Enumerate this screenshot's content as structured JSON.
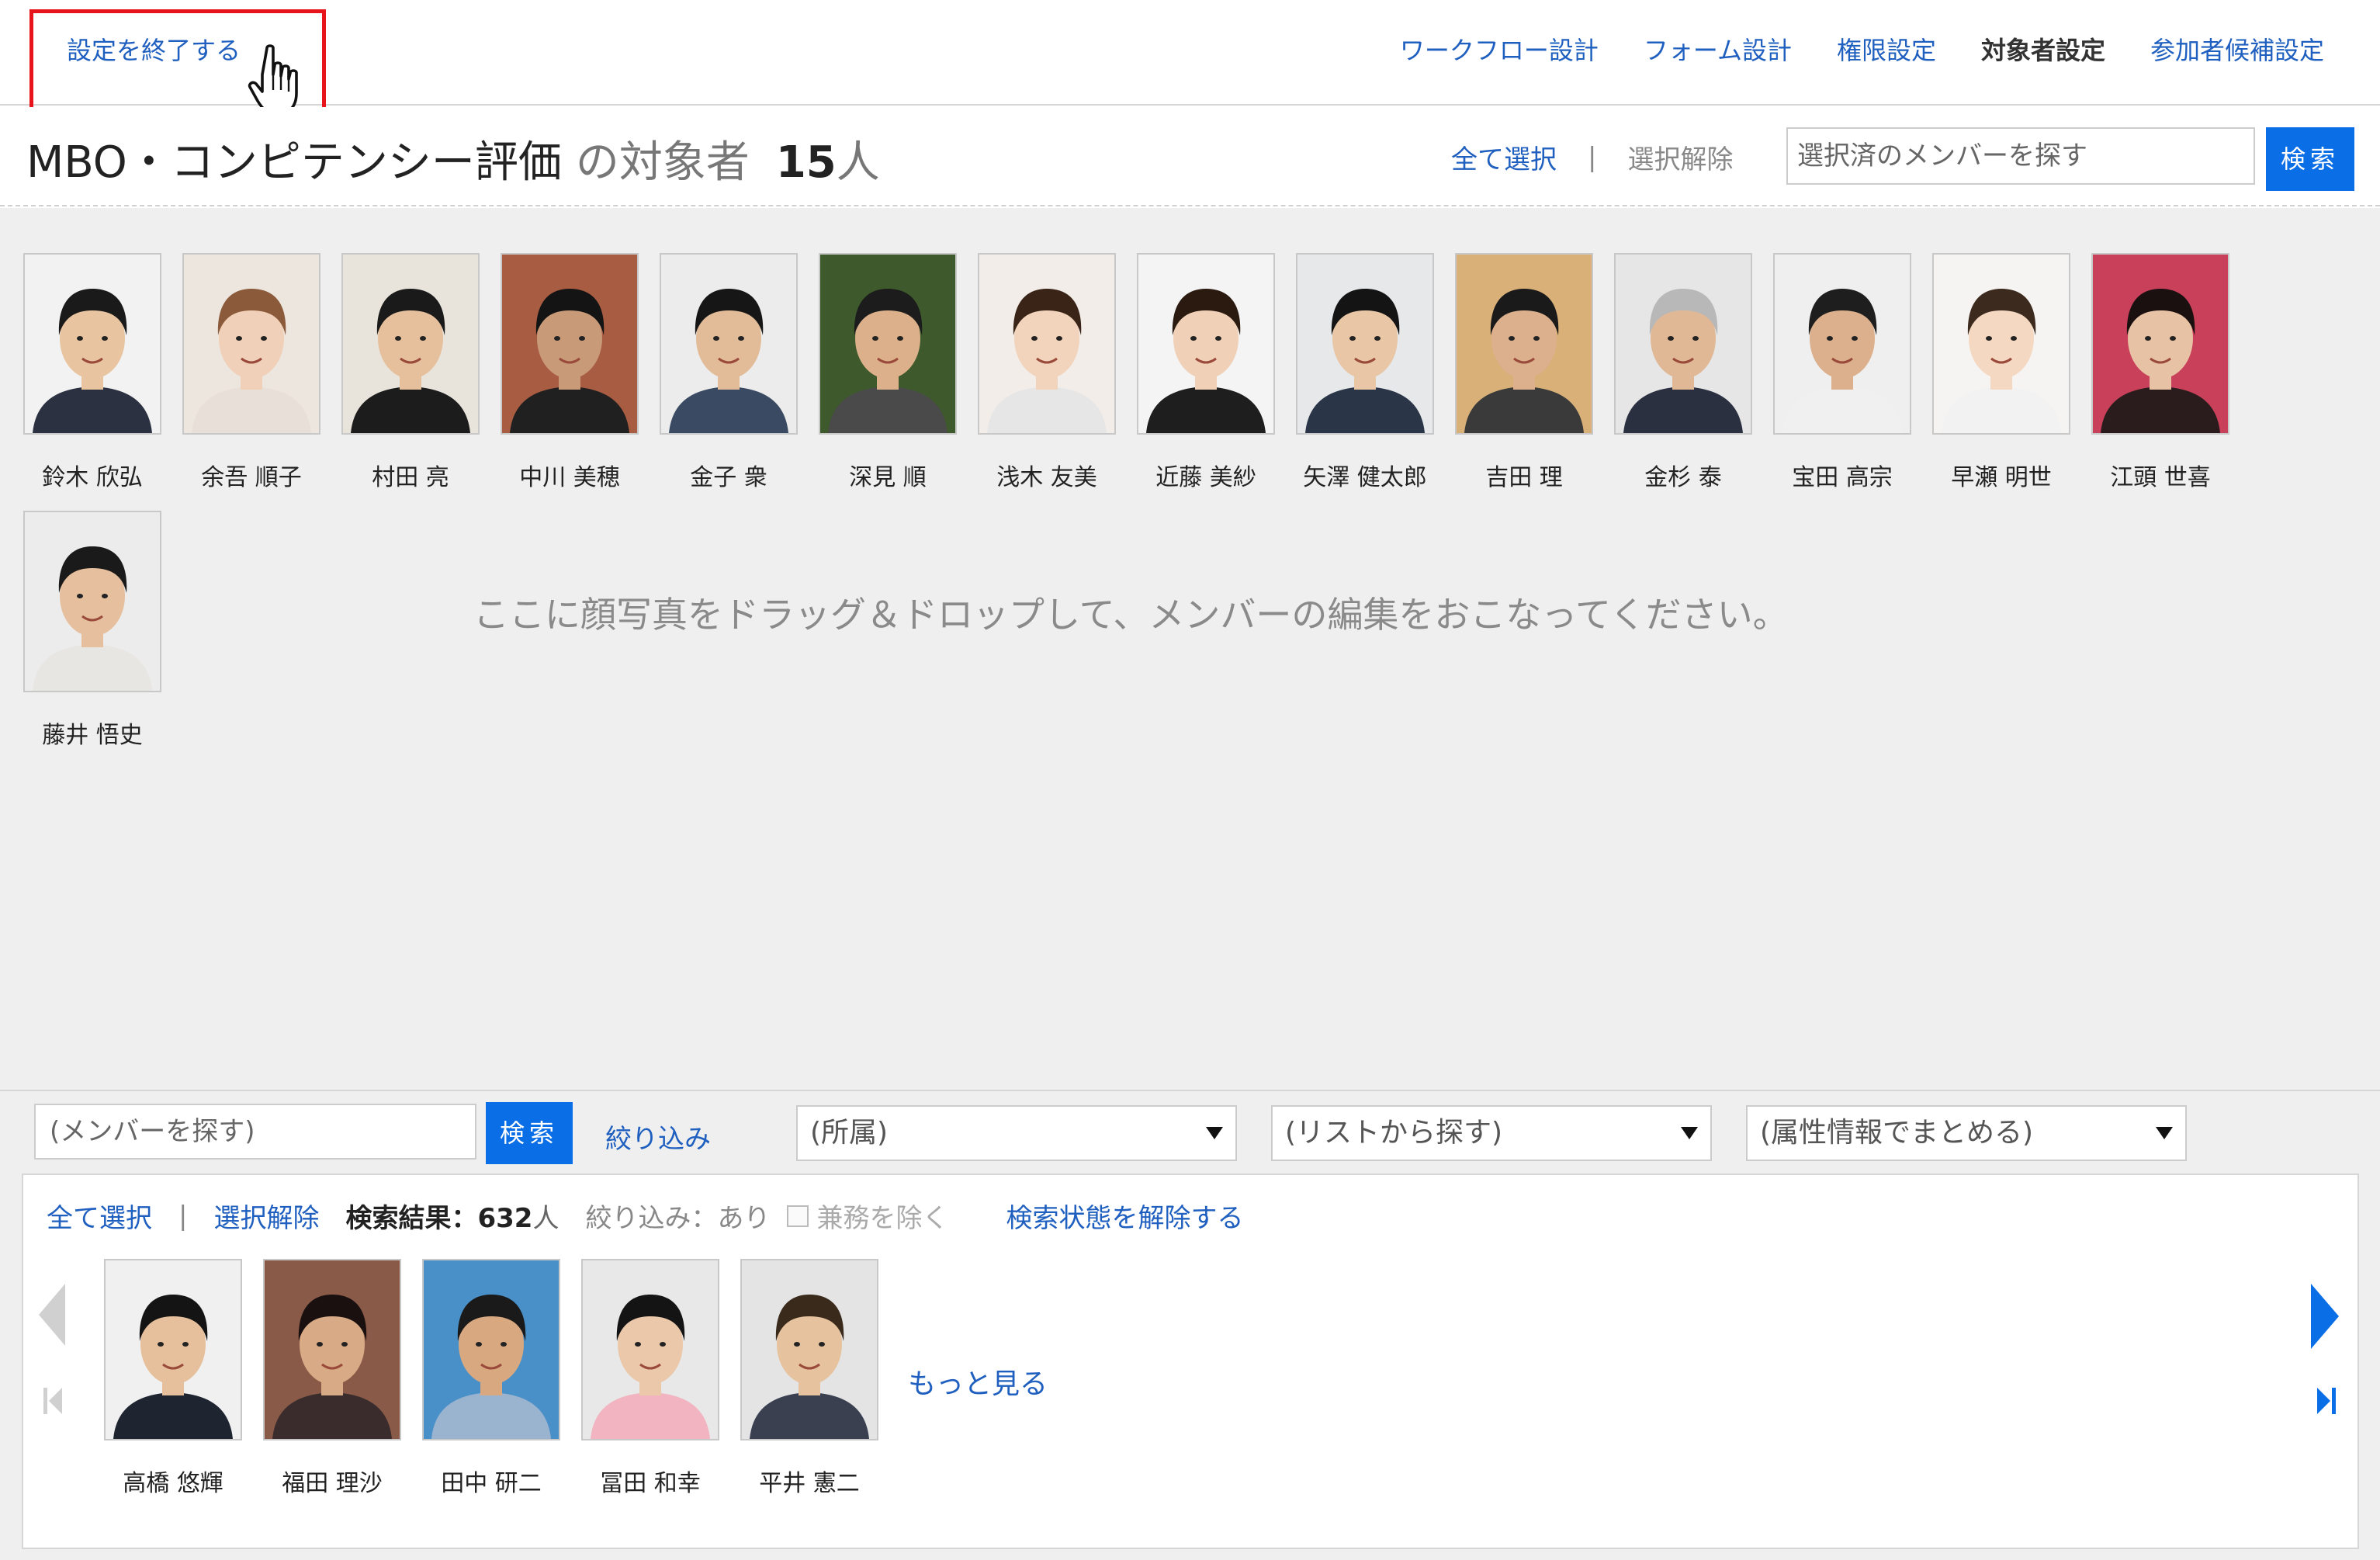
{
  "topnav": {
    "exit_label": "設定を終了する",
    "links": [
      "ワークフロー設計",
      "フォーム設計",
      "権限設定",
      "対象者設定",
      "参加者候補設定"
    ],
    "active_index": 3
  },
  "header": {
    "title_main": "MBO・コンピテンシー評価",
    "title_suffix": "の対象者",
    "count": "15",
    "count_unit": "人",
    "select_all": "全て選択",
    "separator": "|",
    "deselect": "選択解除",
    "search_placeholder": "選択済のメンバーを探す",
    "search_button": "検索"
  },
  "selected_members": [
    {
      "name": "鈴木 欣弘",
      "bg": "#f2f2f2",
      "hair": "#1a1a1a",
      "skin": "#e8c4a0",
      "cloth": "#2b3140"
    },
    {
      "name": "余吾 順子",
      "bg": "#ece6df",
      "hair": "#8a5a3a",
      "skin": "#f0d0b8",
      "cloth": "#e8e0d8"
    },
    {
      "name": "村田 亮",
      "bg": "#e8e4dc",
      "hair": "#1a1a1a",
      "skin": "#e6c09c",
      "cloth": "#1c1c1c"
    },
    {
      "name": "中川 美穂",
      "bg": "#a85c42",
      "hair": "#141414",
      "skin": "#c89a78",
      "cloth": "#202020"
    },
    {
      "name": "金子 衆",
      "bg": "#ececec",
      "hair": "#161616",
      "skin": "#e2bc98",
      "cloth": "#3a4a62"
    },
    {
      "name": "深見 順",
      "bg": "#3e5a2c",
      "hair": "#1c1c1c",
      "skin": "#dcb08a",
      "cloth": "#4a4a4a"
    },
    {
      "name": "浅木 友美",
      "bg": "#f2ede8",
      "hair": "#3a2418",
      "skin": "#f2d4bc",
      "cloth": "#e6e6e6"
    },
    {
      "name": "近藤 美紗",
      "bg": "#f4f4f4",
      "hair": "#2a1a10",
      "skin": "#f0d0b6",
      "cloth": "#1e1e1e"
    },
    {
      "name": "矢澤 健太郎",
      "bg": "#e6e8ea",
      "hair": "#141414",
      "skin": "#e8c6a6",
      "cloth": "#2a3548"
    },
    {
      "name": "吉田 理",
      "bg": "#d8b078",
      "hair": "#1a1a1a",
      "skin": "#dcb08c",
      "cloth": "#3a3a3a"
    },
    {
      "name": "金杉 泰",
      "bg": "#e6e6e6",
      "hair": "#b8b8b8",
      "skin": "#e0b896",
      "cloth": "#2a3040"
    },
    {
      "name": "宝田 高宗",
      "bg": "#efefef",
      "hair": "#1e1e1e",
      "skin": "#dcb08c",
      "cloth": "#f0f0f0"
    },
    {
      "name": "早瀬 明世",
      "bg": "#f6f4f2",
      "hair": "#3c2a1e",
      "skin": "#f4d8c2",
      "cloth": "#f2f2f2"
    },
    {
      "name": "江頭 世喜",
      "bg": "#c8405a",
      "hair": "#1a1010",
      "skin": "#e8c2a4",
      "cloth": "#2a1c1c"
    },
    {
      "name": "藤井 悟史",
      "bg": "#ececec",
      "hair": "#1a1a1a",
      "skin": "#e6c09e",
      "cloth": "#e8e6e2"
    }
  ],
  "drop_hint": "ここに顔写真をドラッグ＆ドロップして、メンバーの編集をおこなってください。",
  "search_bar": {
    "member_search_placeholder": "(メンバーを探す)",
    "search_button": "検索",
    "filter_link": "絞り込み",
    "dept_select": "(所属)",
    "list_select": "(リストから探す)",
    "attr_select": "(属性情報でまとめる)"
  },
  "results": {
    "select_all": "全て選択",
    "separator": "|",
    "deselect": "選択解除",
    "result_label": "検索結果：",
    "result_count": "632",
    "result_unit": "人",
    "filter_state": "絞り込み：あり",
    "exclude_concurrent": "兼務を除く",
    "clear_search": "検索状態を解除する",
    "more": "もっと見る"
  },
  "result_members": [
    {
      "name": "高橋 悠輝",
      "bg": "#f0f0f0",
      "hair": "#141414",
      "skin": "#e6c09c",
      "cloth": "#1e2430"
    },
    {
      "name": "福田 理沙",
      "bg": "#8a5a48",
      "hair": "#1a1010",
      "skin": "#d8aa86",
      "cloth": "#3a2c2c"
    },
    {
      "name": "田中 研二",
      "bg": "#4a90c8",
      "hair": "#1a1a1a",
      "skin": "#d8a880",
      "cloth": "#9ab4d0"
    },
    {
      "name": "冨田 和幸",
      "bg": "#e8e8e8",
      "hair": "#141414",
      "skin": "#ecc8aa",
      "cloth": "#f2b4c0"
    },
    {
      "name": "平井 憲二",
      "bg": "#e4e4e4",
      "hair": "#3a2a1c",
      "skin": "#e6c29e",
      "cloth": "#3a4050"
    }
  ]
}
